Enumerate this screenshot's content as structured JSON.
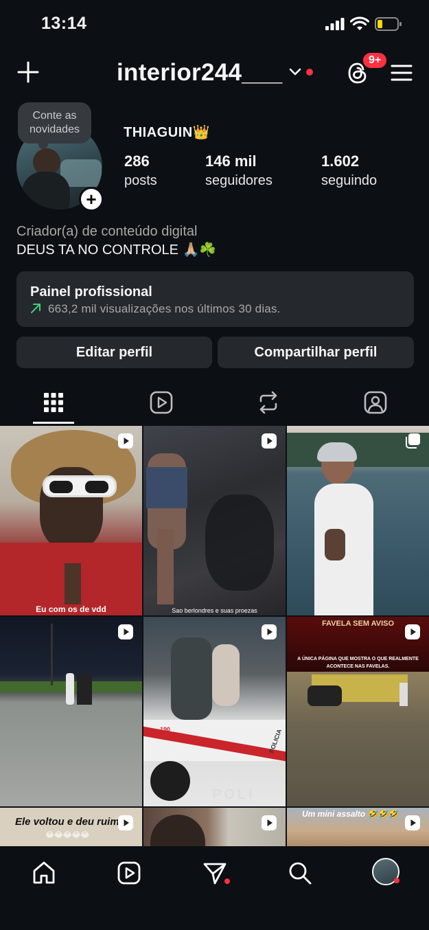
{
  "status_bar": {
    "time": "13:14"
  },
  "header": {
    "username": "interior244___",
    "threads_badge": "9+"
  },
  "profile": {
    "note": "Conte as novidades",
    "display_name": "THIAGUIN👑",
    "stats": [
      {
        "value": "286",
        "label": "posts"
      },
      {
        "value": "146 mil",
        "label": "seguidores"
      },
      {
        "value": "1.602",
        "label": "seguindo"
      }
    ],
    "category": "Criador(a) de conteúdo digital",
    "bio": "DEUS TA NO CONTROLE 🙏🏼☘️"
  },
  "dashboard": {
    "title": "Painel profissional",
    "subtitle": "663,2 mil visualizações nos últimos 30 dias."
  },
  "buttons": {
    "edit": "Editar perfil",
    "share": "Compartilhar perfil"
  },
  "tabs": [
    "grid-icon",
    "reels-icon",
    "reposts-icon",
    "tagged-icon"
  ],
  "grid": {
    "captions": [
      "Eu com os de vdd",
      "Sao berlondres e suas proezas",
      "FAVELA SEM AVISO",
      "A ÚNICA PÁGINA QUE MOSTRA O QUE REALMENTE ACONTECE NAS FAVELAS.",
      "Ele voltou e deu ruim",
      "😂😂😂😂😂",
      "Um mini assalto 🤣🤣🤣",
      "POLICIA",
      "190",
      "POLI"
    ]
  },
  "bottom_nav": [
    "home-icon",
    "reels-icon",
    "messages-icon",
    "search-icon",
    "profile-avatar"
  ],
  "colors": {
    "bg": "#0c1014",
    "card": "#25292e",
    "accent_red": "#ff3040",
    "green_arrow": "#3fd17c"
  }
}
